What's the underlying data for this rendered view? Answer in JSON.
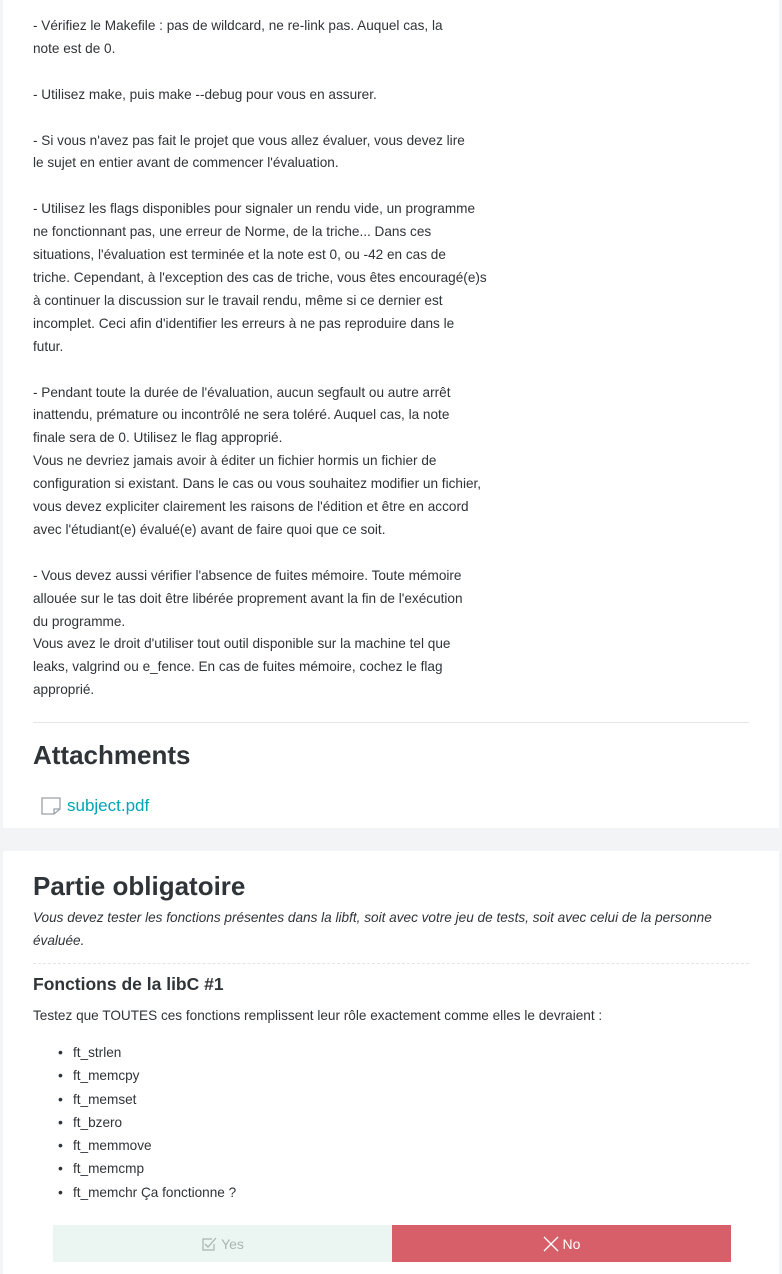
{
  "guidelines": {
    "text": "- Vérifiez le Makefile : pas de wildcard, ne re-link pas. Auquel cas, la\nnote est de 0.\n\n- Utilisez make, puis make --debug pour vous en assurer.\n\n- Si vous n'avez pas fait le projet que vous allez évaluer, vous devez lire\nle sujet en entier avant de commencer l'évaluation.\n\n- Utilisez les flags disponibles pour signaler un rendu vide, un programme\nne fonctionnant pas, une erreur de Norme, de la triche... Dans ces\nsituations, l'évaluation est terminée et la note est 0, ou -42 en cas de\ntriche. Cependant, à l'exception des cas de triche, vous êtes encouragé(e)s\nà continuer la discussion sur le travail rendu, même si ce dernier est\nincomplet. Ceci afin d'identifier les erreurs à ne pas reproduire dans le\nfutur.\n\n- Pendant toute la durée de l'évaluation, aucun segfault ou autre arrêt\ninattendu, prémature ou incontrôlé ne sera toléré. Auquel cas, la note\nfinale sera de 0. Utilisez le flag approprié.\nVous ne devriez jamais avoir à éditer un fichier hormis un fichier de\nconfiguration si existant. Dans le cas ou vous souhaitez modifier un fichier,\nvous devez expliciter clairement les raisons de l'édition et être en accord\navec l'étudiant(e) évalué(e) avant de faire quoi que ce soit.\n\n- Vous devez aussi vérifier l'absence de fuites mémoire. Toute mémoire\nallouée sur le tas doit être libérée proprement avant la fin de l'exécution\ndu programme.\nVous avez le droit d'utiliser tout outil disponible sur la machine tel que\nleaks, valgrind ou e_fence. En cas de fuites mémoire, cochez le flag\napproprié."
  },
  "attachments": {
    "title": "Attachments",
    "files": [
      {
        "name": "subject.pdf",
        "icon": "file-icon"
      }
    ]
  },
  "mandatory": {
    "title": "Partie obligatoire",
    "intro": "Vous devez tester les fonctions présentes dans la libft, soit avec votre jeu de tests, soit avec celui de la personne évaluée.",
    "section": {
      "title": "Fonctions de la libC #1",
      "description": "Testez que TOUTES ces fonctions remplissent leur rôle exactement comme elles le devraient :",
      "functions": [
        "ft_strlen",
        "ft_memcpy",
        "ft_memset",
        "ft_bzero",
        "ft_memmove",
        "ft_memcmp",
        "ft_memchr Ça fonctionne ?"
      ],
      "buttons": {
        "yes": "Yes",
        "no": "No"
      }
    }
  },
  "colors": {
    "accent": "#00a5b5",
    "yes_bg": "#ebf5f2",
    "no_bg": "#d75f6a"
  }
}
